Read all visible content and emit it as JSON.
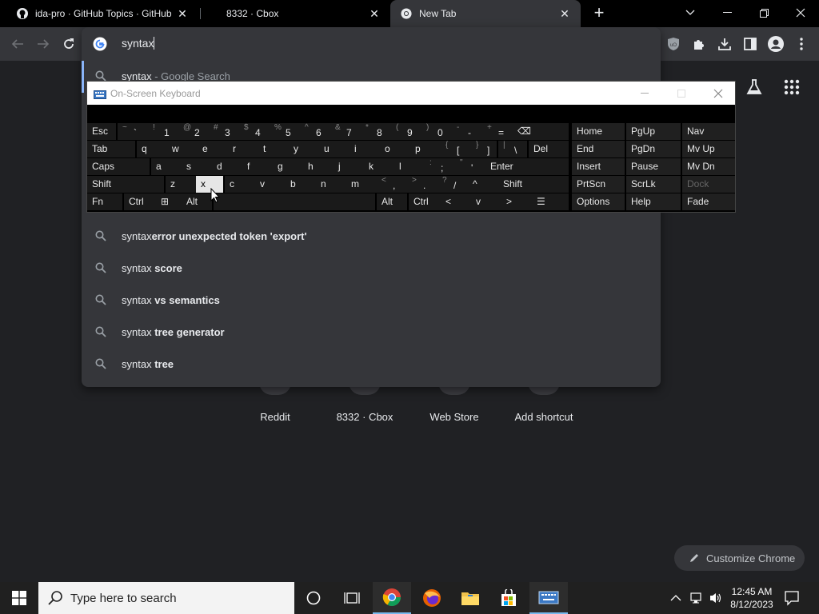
{
  "browser": {
    "tabs": [
      {
        "title": "ida-pro · GitHub Topics · GitHub",
        "icon": "github-icon"
      },
      {
        "title": "8332 · Cbox",
        "icon": "none"
      },
      {
        "title": "New Tab",
        "icon": "chrome-icon",
        "active": true
      }
    ],
    "new_tab_symbol": "+",
    "omnibox": {
      "input_value": "syntax",
      "suggestions": [
        {
          "prefix": "syntax",
          "suffix": " - Google Search",
          "type": "search-what-you-typed"
        },
        {
          "prefix": "syntax",
          "suffix": "error unexpected token 'export'"
        },
        {
          "prefix": "syntax ",
          "suffix": "score"
        },
        {
          "prefix": "syntax ",
          "suffix": "vs semantics"
        },
        {
          "prefix": "syntax ",
          "suffix": "tree generator"
        },
        {
          "prefix": "syntax ",
          "suffix": "tree"
        }
      ]
    },
    "shortcuts": [
      "Reddit",
      "8332 · Cbox",
      "Web Store",
      "Add shortcut"
    ],
    "customize_label": "Customize Chrome"
  },
  "osk": {
    "title": "On-Screen Keyboard",
    "rows": [
      {
        "keys": [
          {
            "l": "Esc"
          },
          {
            "sup": "~",
            "m": "`"
          },
          {
            "sup": "!",
            "m": "1"
          },
          {
            "sup": "@",
            "m": "2"
          },
          {
            "sup": "#",
            "m": "3"
          },
          {
            "sup": "$",
            "m": "4"
          },
          {
            "sup": "%",
            "m": "5"
          },
          {
            "sup": "^",
            "m": "6"
          },
          {
            "sup": "&",
            "m": "7"
          },
          {
            "sup": "*",
            "m": "8"
          },
          {
            "sup": "(",
            "m": "9"
          },
          {
            "sup": ")",
            "m": "0"
          },
          {
            "sup": "-",
            "m": "-"
          },
          {
            "sup": "+",
            "m": "="
          },
          {
            "l": "⌫"
          }
        ]
      },
      {
        "keys": [
          {
            "l": "Tab"
          },
          {
            "l": "q"
          },
          {
            "l": "w"
          },
          {
            "l": "e"
          },
          {
            "l": "r"
          },
          {
            "l": "t"
          },
          {
            "l": "y"
          },
          {
            "l": "u"
          },
          {
            "l": "i"
          },
          {
            "l": "o"
          },
          {
            "l": "p"
          },
          {
            "sup": "{",
            "m": "["
          },
          {
            "sup": "}",
            "m": "]"
          },
          {
            "sup": "|",
            "m": "\\"
          },
          {
            "l": "Del"
          }
        ]
      },
      {
        "keys": [
          {
            "l": "Caps"
          },
          {
            "l": "a"
          },
          {
            "l": "s"
          },
          {
            "l": "d"
          },
          {
            "l": "f"
          },
          {
            "l": "g"
          },
          {
            "l": "h"
          },
          {
            "l": "j"
          },
          {
            "l": "k"
          },
          {
            "l": "l"
          },
          {
            "sup": ":",
            "m": ";"
          },
          {
            "sup": "\"",
            "m": "'"
          },
          {
            "l": "Enter"
          }
        ]
      },
      {
        "keys": [
          {
            "l": "Shift"
          },
          {
            "l": "z"
          },
          {
            "l": "x"
          },
          {
            "l": "c"
          },
          {
            "l": "v"
          },
          {
            "l": "b"
          },
          {
            "l": "n"
          },
          {
            "l": "m"
          },
          {
            "sup": "<",
            "m": ","
          },
          {
            "sup": ">",
            "m": "."
          },
          {
            "sup": "?",
            "m": "/"
          },
          {
            "l": "^"
          },
          {
            "l": "Shift"
          }
        ]
      },
      {
        "keys": [
          {
            "l": "Fn"
          },
          {
            "l": "Ctrl"
          },
          {
            "l": "⊞"
          },
          {
            "l": "Alt"
          },
          {
            "l": ""
          },
          {
            "l": "Alt"
          },
          {
            "l": "Ctrl"
          },
          {
            "l": "<"
          },
          {
            "l": "v"
          },
          {
            "l": ">"
          },
          {
            "l": "☰"
          }
        ]
      }
    ],
    "nav_keys": [
      [
        "Home",
        "PgUp",
        "Nav"
      ],
      [
        "End",
        "PgDn",
        "Mv Up"
      ],
      [
        "Insert",
        "Pause",
        "Mv Dn"
      ],
      [
        "PrtScn",
        "ScrLk",
        "Dock"
      ],
      [
        "Options",
        "Help",
        "Fade"
      ]
    ],
    "pressed_key": "x"
  },
  "taskbar": {
    "search_placeholder": "Type here to search",
    "time": "12:45 AM",
    "date": "8/12/2023",
    "apps": [
      "cortana-icon",
      "task-view-icon",
      "chrome-icon",
      "firefox-icon",
      "file-explorer-icon",
      "store-icon",
      "osk-icon"
    ]
  }
}
